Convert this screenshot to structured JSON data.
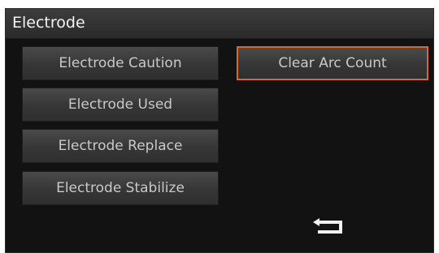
{
  "screen": {
    "title": "Electrode"
  },
  "menu": {
    "electrode_caution": "Electrode Caution",
    "electrode_used": "Electrode Used",
    "electrode_replace": "Electrode Replace",
    "electrode_stabilize": "Electrode Stabilize",
    "clear_arc_count": "Clear Arc Count"
  },
  "icons": {
    "back": "return-arrow-icon"
  },
  "colors": {
    "background": "#121212",
    "button": "#3a3a3a",
    "text": "#c9c9c9",
    "accent": "#d9692a"
  }
}
